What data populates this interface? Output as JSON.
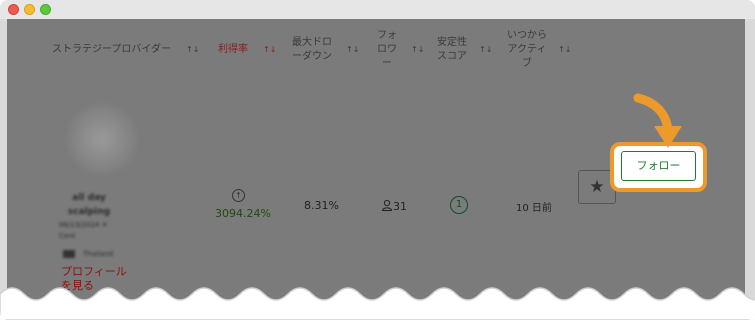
{
  "table": {
    "headers": {
      "provider": "ストラテジープロバイダー",
      "rate": "利得率",
      "drawdown": "最大ドロ\nーダウン",
      "followers": "フォ\nロワ\nー",
      "stability": "安定性\nスコア",
      "active_since": "いつから\nアクティ\nブ"
    },
    "sort_indicator": "↑↓",
    "row": {
      "name": "all day\nscalping",
      "meta_date": "06/13/2024  ✕",
      "meta_cent": "Cent",
      "country": "Thailand",
      "profile_link": "プロフィール\nを見る",
      "growth_icon": "↑",
      "return_rate": "3094.24%",
      "max_drawdown": "8.31%",
      "followers_count": "31",
      "stability_score": "1",
      "active_since": "10 日前",
      "favorite_icon": "star-icon",
      "follow_label": "フォロー"
    }
  },
  "colors": {
    "overlay": "#7b7b7b",
    "highlight": "#ed9a2c",
    "follow_green": "#1f7a36",
    "link_red": "#8a1010"
  }
}
